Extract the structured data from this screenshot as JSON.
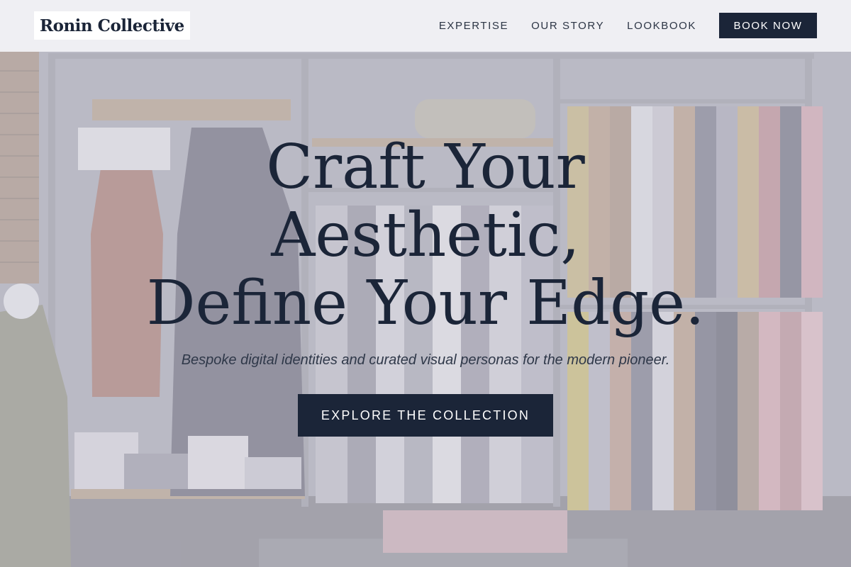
{
  "brand": {
    "name": "Ronin Collective"
  },
  "nav": {
    "links": [
      "EXPERTISE",
      "OUR STORY",
      "LOOKBOOK"
    ],
    "book_label": "BOOK NOW"
  },
  "hero": {
    "title_lines": [
      "Craft Your",
      "Aesthetic,",
      "Define Your Edge."
    ],
    "subtitle": "Bespoke digital identities and curated visual personas for the modern pioneer.",
    "cta_label": "EXPLORE THE COLLECTION",
    "background": "clothing-boutique-photo"
  },
  "colors": {
    "primary": "#1b2538",
    "header_bg": "#f3f3f6",
    "button_text": "#ffffff"
  }
}
